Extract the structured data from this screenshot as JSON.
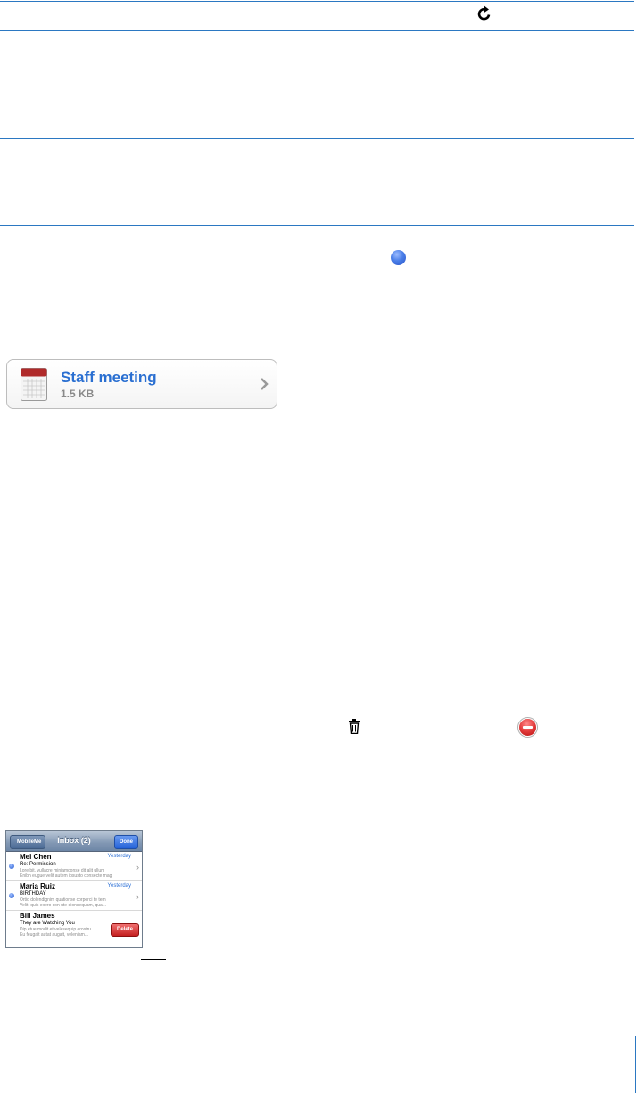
{
  "attachment": {
    "name": "Staff meeting",
    "size": "1.5 KB",
    "icon": "calendar-icon"
  },
  "icons": {
    "refresh": "refresh-icon",
    "unread": "blue-dot-icon",
    "trash": "trash-icon",
    "delete_circle": "minus-circle-icon"
  },
  "inbox": {
    "back_label": "MobileMe",
    "title": "Inbox (2)",
    "done_label": "Done",
    "messages": [
      {
        "sender": "Mei Chen",
        "date": "Yesterday",
        "subject": "Re: Permission",
        "preview1": "Lore bit, vullacre miniamconse dit alit ullum",
        "preview2": "Enibh eugue velit autem ipsusto consecte mag",
        "unread": true
      },
      {
        "sender": "Maria Ruiz",
        "date": "Yesterday",
        "subject": "BIRTHDAY",
        "preview1": "Ortio dolendignim quationse corperci te tem",
        "preview2": "Velit, quis exero con ute dionsequam, qua...",
        "unread": true
      },
      {
        "sender": "Bill James",
        "subject": "They are Watching You",
        "preview1": "Dip etue modit et velesequip erostru",
        "preview2": "Eu feugait autat augait, veleniam...",
        "delete_label": "Delete",
        "unread": false
      }
    ]
  },
  "colors": {
    "rule": "#2b78c2",
    "link_blue": "#2a6fd1",
    "delete_red": "#c41f1f"
  }
}
